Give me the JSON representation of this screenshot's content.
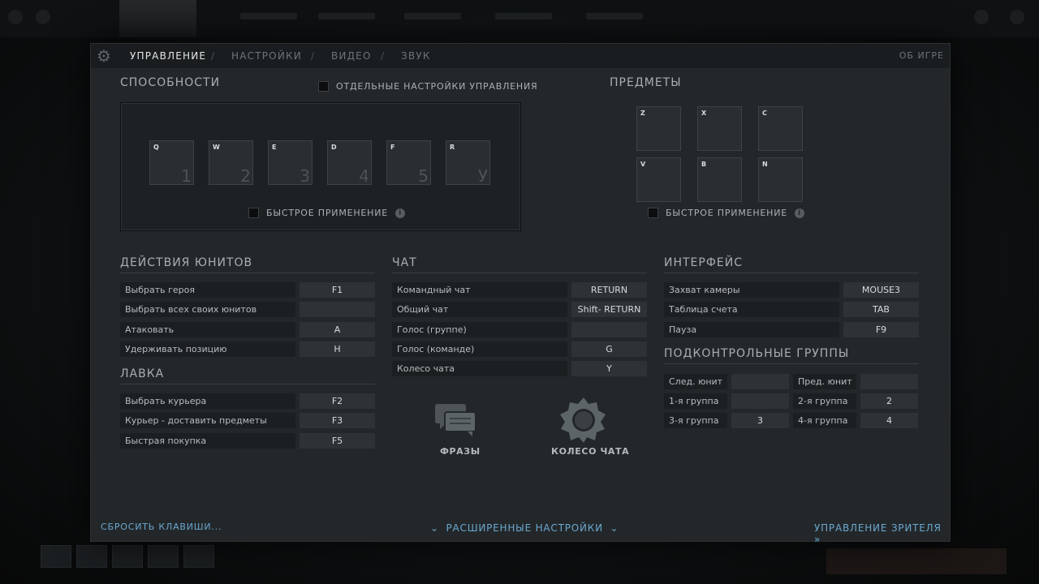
{
  "tabs": [
    {
      "label": "УПРАВЛЕНИЕ"
    },
    {
      "label": "НАСТРОЙКИ"
    },
    {
      "label": "ВИДЕО"
    },
    {
      "label": "ЗВУК"
    }
  ],
  "about_label": "ОБ ИГРЕ",
  "abilities": {
    "title": "СПОСОБНОСТИ",
    "separate_settings": "ОТДЕЛЬНЫЕ НАСТРОЙКИ УПРАВЛЕНИЯ",
    "quick_cast": "БЫСТРОЕ ПРИМЕНЕНИЕ",
    "slots": [
      {
        "key": "Q",
        "num": "1"
      },
      {
        "key": "W",
        "num": "2"
      },
      {
        "key": "E",
        "num": "3"
      },
      {
        "key": "D",
        "num": "4"
      },
      {
        "key": "F",
        "num": "5"
      },
      {
        "key": "R",
        "num": "У"
      }
    ]
  },
  "items": {
    "title": "ПРЕДМЕТЫ",
    "quick_cast": "БЫСТРОЕ ПРИМЕНЕНИЕ",
    "slots": [
      {
        "key": "Z"
      },
      {
        "key": "X"
      },
      {
        "key": "C"
      },
      {
        "key": "V"
      },
      {
        "key": "B"
      },
      {
        "key": "N"
      }
    ]
  },
  "unit_actions": {
    "title": "ДЕЙСТВИЯ ЮНИТОВ",
    "rows": [
      {
        "label": "Выбрать героя",
        "key": "F1"
      },
      {
        "label": "Выбрать всех своих юнитов",
        "key": ""
      },
      {
        "label": "Атаковать",
        "key": "A"
      },
      {
        "label": "Удерживать позицию",
        "key": "H"
      }
    ]
  },
  "shop": {
    "title": "ЛАВКА",
    "rows": [
      {
        "label": "Выбрать курьера",
        "key": "F2"
      },
      {
        "label": "Курьер - доставить предметы",
        "key": "F3"
      },
      {
        "label": "Быстрая покупка",
        "key": "F5"
      }
    ]
  },
  "chat": {
    "title": "ЧАТ",
    "rows": [
      {
        "label": "Командный чат",
        "key": "RETURN"
      },
      {
        "label": "Общий чат",
        "key": "Shift- RETURN"
      },
      {
        "label": "Голос (группе)",
        "key": ""
      },
      {
        "label": "Голос (команде)",
        "key": "G"
      },
      {
        "label": "Колесо чата",
        "key": "Y"
      }
    ],
    "phrases_label": "ФРАЗЫ",
    "wheel_label": "КОЛЕСО ЧАТА"
  },
  "interface": {
    "title": "ИНТЕРФЕЙС",
    "rows": [
      {
        "label": "Захват камеры",
        "key": "MOUSE3"
      },
      {
        "label": "Таблица счета",
        "key": "TAB"
      },
      {
        "label": "Пауза",
        "key": "F9"
      }
    ]
  },
  "control_groups": {
    "title": "ПОДКОНТРОЛЬНЫЕ ГРУППЫ",
    "rows": [
      [
        {
          "label": "След. юнит",
          "key": ""
        },
        {
          "label": "Пред. юнит",
          "key": ""
        }
      ],
      [
        {
          "label": "1-я группа",
          "key": ""
        },
        {
          "label": "2-я группа",
          "key": "2"
        }
      ],
      [
        {
          "label": "3-я группа",
          "key": "3"
        },
        {
          "label": "4-я группа",
          "key": "4"
        }
      ]
    ]
  },
  "footer": {
    "reset": "СБРОСИТЬ КЛАВИШИ...",
    "advanced": "РАСШИРЕННЫЕ НАСТРОЙКИ",
    "spectator": "УПРАВЛЕНИЕ ЗРИТЕЛЯ"
  },
  "colors": {
    "accent": "#6aa8cf",
    "panel": "#23272a"
  }
}
